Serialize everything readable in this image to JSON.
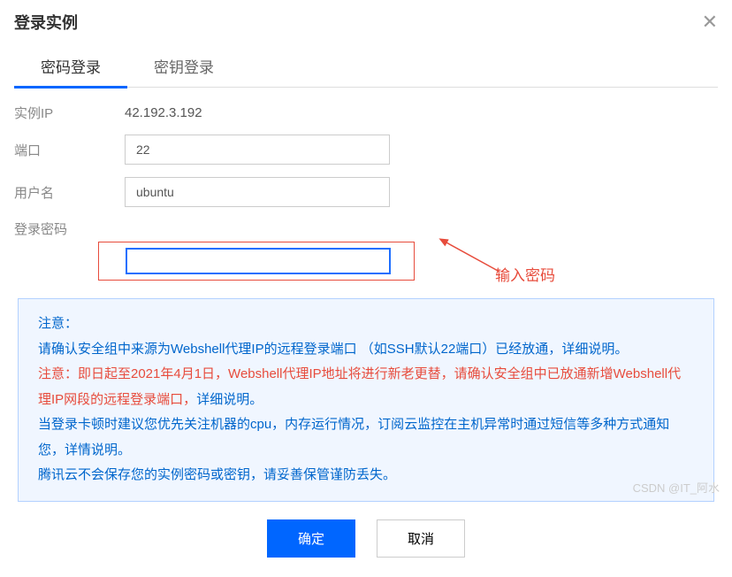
{
  "header": {
    "title": "登录实例",
    "close": "✕"
  },
  "tabs": {
    "password": "密码登录",
    "key": "密钥登录"
  },
  "form": {
    "ip_label": "实例IP",
    "ip_value": "42.192.3.192",
    "port_label": "端口",
    "port_value": "22",
    "user_label": "用户名",
    "user_value": "ubuntu",
    "pwd_label": "登录密码"
  },
  "annotation": "输入密码",
  "notice": {
    "l1a": "注意：",
    "l2a": "请确认安全组中来源为",
    "l2b": "Webshell代理IP",
    "l2c": "的远程登录端口 （如SSH默认22端口）已经放通，",
    "l2d": "详细说明",
    "l2e": "。",
    "l3": "注意：即日起至2021年4月1日，Webshell代理IP地址将进行新老更替，请确认安全组中已放通新增Webshell代理IP网段的远程登录端口，",
    "l3b": "详细说明",
    "l3c": "。",
    "l4a": "当登录卡顿时建议您优先关注机器的cpu，内存运行情况，订阅",
    "l4b": "云监控",
    "l4c": "在主机异常时通过短信等多种方式通知您，",
    "l4d": "详情说明",
    "l4e": "。",
    "l5": "腾讯云不会保存您的实例密码或密钥，请妥善保管谨防丢失。"
  },
  "buttons": {
    "ok": "确定",
    "cancel": "取消"
  },
  "watermark": "CSDN @IT_阿水"
}
